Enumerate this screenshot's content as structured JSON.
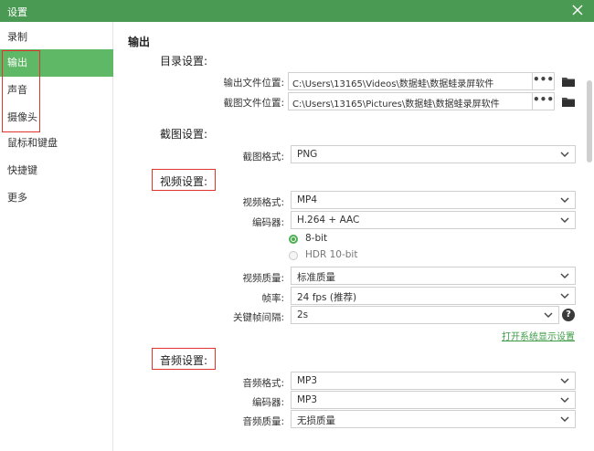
{
  "window": {
    "title": "设置"
  },
  "sidebar": {
    "items": [
      {
        "label": "录制"
      },
      {
        "label": "输出"
      },
      {
        "label": "声音"
      },
      {
        "label": "摄像头"
      },
      {
        "label": "鼠标和键盘"
      },
      {
        "label": "快捷键"
      },
      {
        "label": "更多"
      }
    ]
  },
  "main": {
    "title": "输出",
    "directory": {
      "heading": "目录设置:",
      "output_label": "输出文件位置:",
      "output_path": "C:\\Users\\13165\\Videos\\数据蛙\\数据蛙录屏软件",
      "screenshot_label": "截图文件位置:",
      "screenshot_path": "C:\\Users\\13165\\Pictures\\数据蛙\\数据蛙录屏软件",
      "browse": "•••"
    },
    "screenshot": {
      "heading": "截图设置:",
      "format_label": "截图格式:",
      "format_value": "PNG"
    },
    "video": {
      "heading": "视频设置:",
      "format_label": "视频格式:",
      "format_value": "MP4",
      "encoder_label": "编码器:",
      "encoder_value": "H.264 + AAC",
      "bit_8": "8-bit",
      "hdr": "HDR 10-bit",
      "quality_label": "视频质量:",
      "quality_value": "标准质量",
      "fps_label": "帧率:",
      "fps_value": "24 fps (推荐)",
      "keyframe_label": "关键帧间隔:",
      "keyframe_value": "2s",
      "help": "?",
      "display_link": "打开系统显示设置"
    },
    "audio": {
      "heading": "音频设置:",
      "format_label": "音频格式:",
      "format_value": "MP3",
      "encoder_label": "编码器:",
      "encoder_value": "MP3",
      "quality_label": "音频质量:",
      "quality_value": "无损质量"
    }
  },
  "colors": {
    "title_bar": "#4a9a53",
    "active_nav": "#5fb865",
    "highlight": "#e0342f",
    "link": "#3c9c46"
  }
}
